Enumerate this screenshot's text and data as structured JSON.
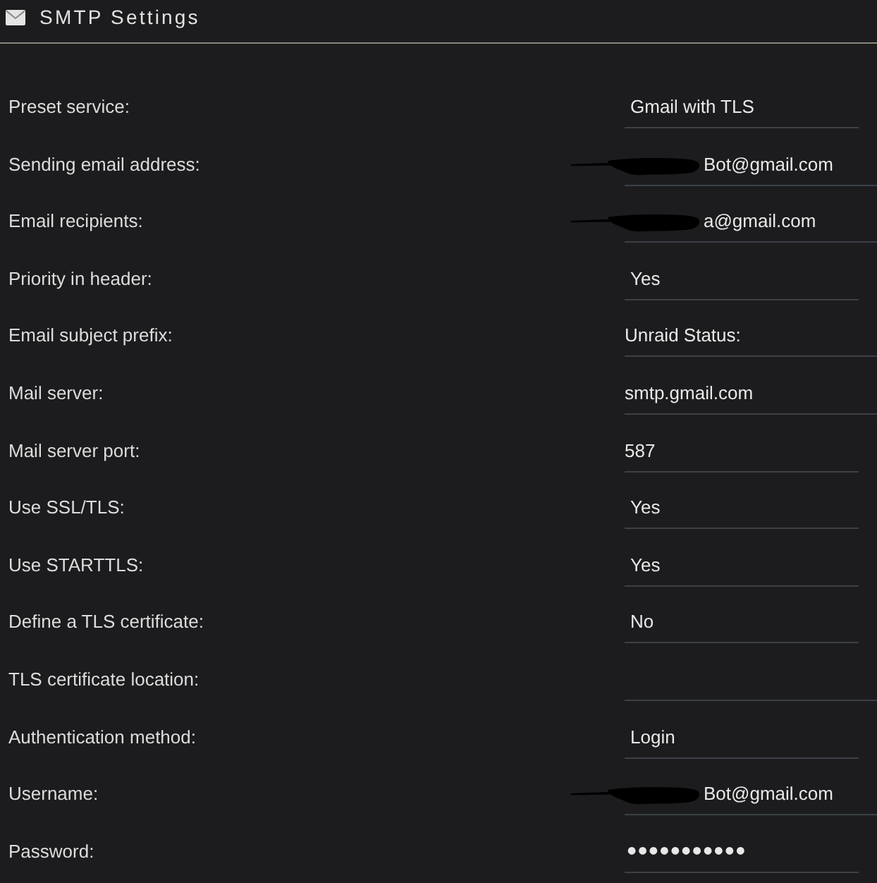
{
  "header": {
    "title": "SMTP Settings"
  },
  "rows": [
    {
      "label": "Preset service:",
      "field": {
        "kind": "select",
        "value": "Gmail with TLS",
        "redacted": false
      }
    },
    {
      "label": "Sending email address:",
      "field": {
        "kind": "text",
        "value": "Bot@gmail.com",
        "redacted": true
      }
    },
    {
      "label": "Email recipients:",
      "field": {
        "kind": "text",
        "value": "a@gmail.com",
        "redacted": true
      }
    },
    {
      "label": "Priority in header:",
      "field": {
        "kind": "select",
        "value": "Yes",
        "redacted": false
      }
    },
    {
      "label": "Email subject prefix:",
      "field": {
        "kind": "text",
        "value": "Unraid Status:",
        "redacted": false
      }
    },
    {
      "label": "Mail server:",
      "field": {
        "kind": "text",
        "value": "smtp.gmail.com",
        "redacted": false
      }
    },
    {
      "label": "Mail server port:",
      "field": {
        "kind": "number",
        "value": "587",
        "redacted": false
      }
    },
    {
      "label": "Use SSL/TLS:",
      "field": {
        "kind": "select",
        "value": "Yes",
        "redacted": false
      }
    },
    {
      "label": "Use STARTTLS:",
      "field": {
        "kind": "select",
        "value": "Yes",
        "redacted": false
      }
    },
    {
      "label": "Define a TLS certificate:",
      "field": {
        "kind": "select",
        "value": "No",
        "redacted": false
      }
    },
    {
      "label": "TLS certificate location:",
      "field": {
        "kind": "text",
        "redacted": false
      }
    },
    {
      "label": "Authentication method:",
      "field": {
        "kind": "select",
        "value": "Login",
        "redacted": false
      }
    },
    {
      "label": "Username:",
      "field": {
        "kind": "text",
        "value": "Bot@gmail.com",
        "redacted": true
      }
    },
    {
      "label": "Password:",
      "field": {
        "kind": "password",
        "value": "●●●●●●●●●●●",
        "redacted": false
      }
    }
  ]
}
